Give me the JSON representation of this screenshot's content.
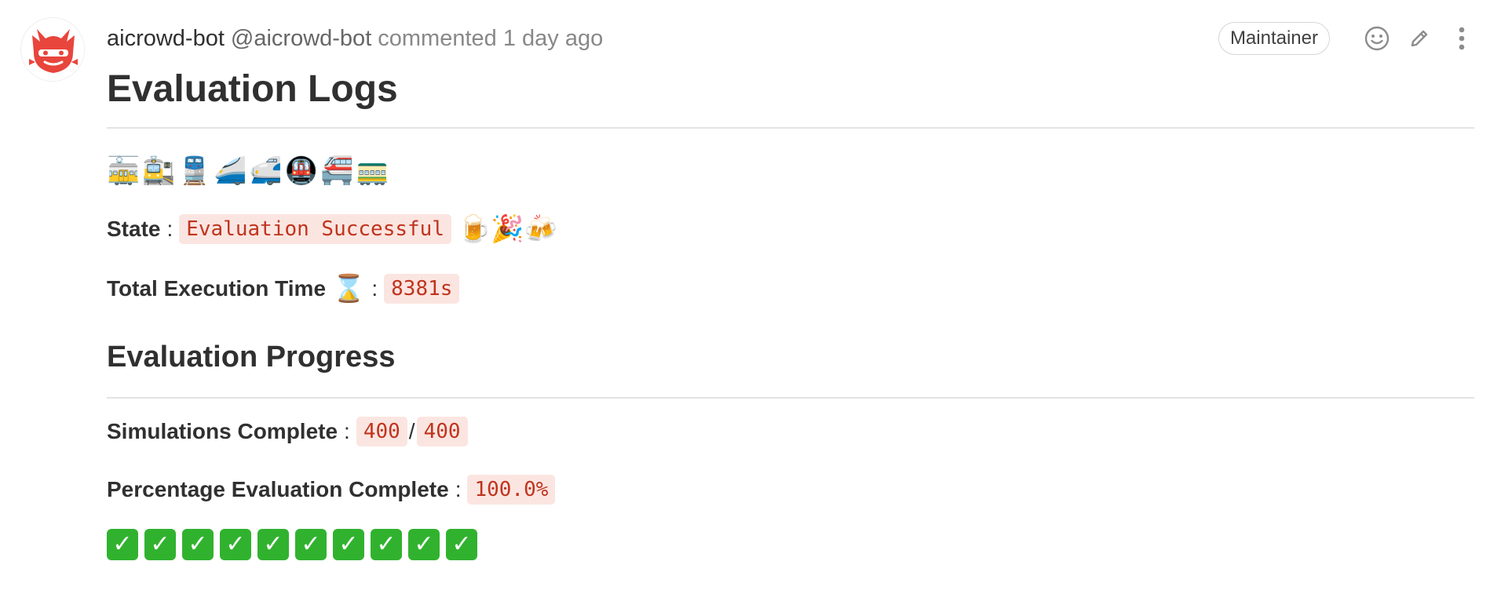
{
  "comment": {
    "author_name": "aicrowd-bot",
    "author_handle": "@aicrowd-bot",
    "meta": "commented 1 day ago",
    "role_badge": "Maintainer"
  },
  "icons": {
    "avatar": "aicrowd-logo",
    "emoji_reaction": "smiley-icon",
    "edit": "pencil-icon",
    "more": "kebab-menu-icon"
  },
  "body": {
    "title": "Evaluation Logs",
    "train_emojis": "🚋🚉🚆🚄🚅🚇🚝🚃",
    "state_label": "State",
    "state_sep": ":",
    "state_value": "Evaluation Successful",
    "state_emojis": "🍺🎉🍻",
    "time_label": "Total Execution Time",
    "time_emoji": "⌛",
    "time_sep": ":",
    "time_value": "8381s",
    "progress_heading": "Evaluation Progress",
    "sims_label": "Simulations Complete",
    "sims_sep": ":",
    "sims_done": "400",
    "sims_slash": "/",
    "sims_total": "400",
    "pct_label": "Percentage Evaluation Complete",
    "pct_sep": ":",
    "pct_value": "100.0%",
    "checks": [
      "✓",
      "✓",
      "✓",
      "✓",
      "✓",
      "✓",
      "✓",
      "✓",
      "✓",
      "✓"
    ]
  },
  "colors": {
    "code_text": "#c0341d",
    "code_bg": "#fbe5e1",
    "check_green": "#31b22f",
    "logo_red": "#e8453c"
  }
}
